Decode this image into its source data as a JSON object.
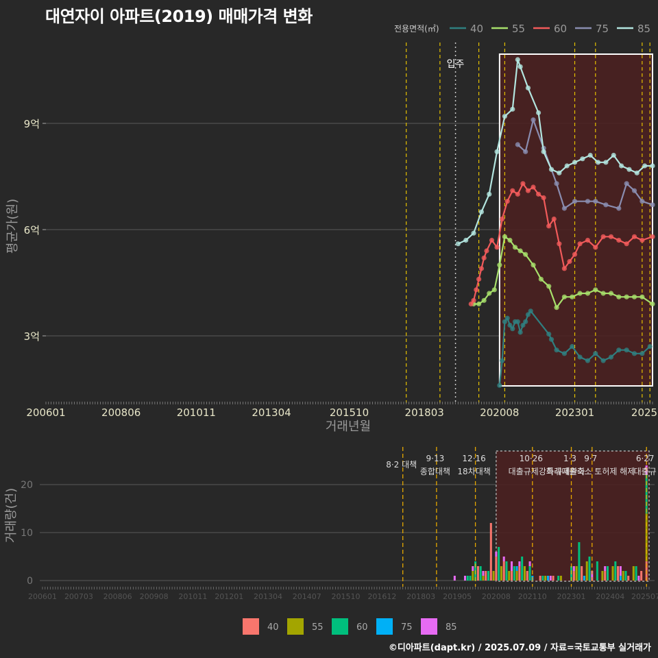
{
  "title": "대연자이 아파트(2019) 매매가격 변화",
  "footer": "©디아파트(dapt.kr) / 2025.07.09 / 자료=국토교통부 실거래가",
  "colors": {
    "background": "#282828",
    "grid": "#5a5a5a",
    "policy_line": "#e6c200",
    "highlight_fill": "#4a2020",
    "highlight_border": "#ffffff"
  },
  "chart_data": [
    {
      "type": "line",
      "title": "대연자이 아파트(2019) 매매가격 변화",
      "xlabel": "거래년월",
      "ylabel": "평균가(원)",
      "x_ticks": [
        "200601",
        "200806",
        "201011",
        "201304",
        "201510",
        "201803",
        "202008",
        "202301",
        "2025"
      ],
      "y_ticks": [
        {
          "value": 3,
          "label": "3억"
        },
        {
          "value": 6,
          "label": "6억"
        },
        {
          "value": 9,
          "label": "9억"
        }
      ],
      "ylim": [
        1.3,
        11.4
      ],
      "legend_title": "전용면적(㎡)",
      "legend_position": "top-right",
      "annotation": "입주",
      "policy_dates": [
        "2017-08",
        "2018-09",
        "2019-12",
        "2020-10",
        "2023-01",
        "2023-09",
        "2025-03",
        "2025-06"
      ],
      "highlight_range": [
        "2020-08",
        "2025-07"
      ],
      "series": [
        {
          "name": "40",
          "color": "#2f7f80",
          "x": [
            "2020-08",
            "2020-09",
            "2020-10",
            "2020-11",
            "2020-12",
            "2021-01",
            "2021-02",
            "2021-03",
            "2021-04",
            "2021-05",
            "2021-06",
            "2021-07",
            "2021-08",
            "2022-03",
            "2022-04",
            "2022-06",
            "2022-09",
            "2022-12",
            "2023-03",
            "2023-06",
            "2023-09",
            "2023-12",
            "2024-03",
            "2024-06",
            "2024-09",
            "2024-12",
            "2025-03",
            "2025-06"
          ],
          "y": [
            1.6,
            2.3,
            3.4,
            3.5,
            3.3,
            3.2,
            3.4,
            3.4,
            3.1,
            3.3,
            3.4,
            3.6,
            3.7,
            3.05,
            2.9,
            2.6,
            2.5,
            2.7,
            2.4,
            2.3,
            2.5,
            2.3,
            2.4,
            2.6,
            2.6,
            2.5,
            2.5,
            2.7
          ]
        },
        {
          "name": "55",
          "color": "#a7e06b",
          "x": [
            "2019-10",
            "2019-12",
            "2020-02",
            "2020-04",
            "2020-06",
            "2020-08",
            "2020-10",
            "2020-12",
            "2021-02",
            "2021-04",
            "2021-06",
            "2021-09",
            "2021-12",
            "2022-03",
            "2022-06",
            "2022-09",
            "2022-12",
            "2023-03",
            "2023-06",
            "2023-09",
            "2023-12",
            "2024-03",
            "2024-06",
            "2024-09",
            "2024-12",
            "2025-03",
            "2025-07"
          ],
          "y": [
            3.9,
            3.9,
            4.0,
            4.2,
            4.3,
            5.0,
            5.8,
            5.7,
            5.5,
            5.4,
            5.3,
            5.0,
            4.6,
            4.4,
            3.8,
            4.1,
            4.1,
            4.2,
            4.2,
            4.3,
            4.2,
            4.2,
            4.1,
            4.1,
            4.1,
            4.1,
            3.9
          ]
        },
        {
          "name": "60",
          "color": "#f25b5b",
          "x": [
            "2019-09",
            "2019-10",
            "2019-11",
            "2019-12",
            "2020-01",
            "2020-02",
            "2020-03",
            "2020-05",
            "2020-07",
            "2020-09",
            "2020-11",
            "2021-01",
            "2021-03",
            "2021-05",
            "2021-07",
            "2021-09",
            "2021-11",
            "2022-01",
            "2022-03",
            "2022-05",
            "2022-07",
            "2022-09",
            "2022-11",
            "2023-01",
            "2023-03",
            "2023-06",
            "2023-09",
            "2023-12",
            "2024-03",
            "2024-06",
            "2024-09",
            "2024-12",
            "2025-03",
            "2025-07"
          ],
          "y": [
            3.9,
            4.0,
            4.3,
            4.6,
            4.9,
            5.2,
            5.4,
            5.7,
            5.5,
            6.3,
            6.8,
            7.1,
            7.0,
            7.3,
            7.1,
            7.2,
            7.0,
            6.9,
            6.1,
            6.3,
            5.6,
            4.9,
            5.1,
            5.3,
            5.6,
            5.7,
            5.5,
            5.8,
            5.8,
            5.7,
            5.6,
            5.8,
            5.7,
            5.8
          ]
        },
        {
          "name": "75",
          "color": "#8a8db0",
          "x": [
            "2021-03",
            "2021-06",
            "2021-09",
            "2022-01",
            "2022-06",
            "2022-09",
            "2023-01",
            "2023-06",
            "2023-09",
            "2024-01",
            "2024-06",
            "2024-09",
            "2024-12",
            "2025-03",
            "2025-07"
          ],
          "y": [
            8.4,
            8.2,
            9.1,
            8.3,
            7.3,
            6.6,
            6.8,
            6.8,
            6.8,
            6.7,
            6.6,
            7.3,
            7.1,
            6.8,
            6.7
          ]
        },
        {
          "name": "85",
          "color": "#b3e6e0",
          "x": [
            "2019-04",
            "2019-07",
            "2019-10",
            "2020-01",
            "2020-04",
            "2020-07",
            "2020-10",
            "2021-01",
            "2021-03",
            "2021-04",
            "2021-07",
            "2021-11",
            "2022-01",
            "2022-04",
            "2022-07",
            "2022-10",
            "2023-01",
            "2023-04",
            "2023-07",
            "2023-10",
            "2024-01",
            "2024-04",
            "2024-07",
            "2024-10",
            "2025-01",
            "2025-04",
            "2025-07"
          ],
          "y": [
            5.6,
            5.7,
            5.9,
            6.5,
            7.0,
            8.2,
            9.2,
            9.4,
            10.8,
            10.6,
            10.0,
            9.3,
            8.2,
            7.7,
            7.6,
            7.8,
            7.9,
            8.0,
            8.1,
            7.9,
            7.9,
            8.1,
            7.8,
            7.7,
            7.6,
            7.8,
            7.8
          ]
        }
      ]
    },
    {
      "type": "bar",
      "xlabel": "",
      "ylabel": "거래량(건)",
      "x_ticks": [
        "200601",
        "200703",
        "200806",
        "200908",
        "201011",
        "201201",
        "201304",
        "201407",
        "201510",
        "201612",
        "201803",
        "201905",
        "202008",
        "202110",
        "202301",
        "202404",
        "202507"
      ],
      "y_ticks": [
        0,
        10,
        20
      ],
      "ylim": [
        -1,
        27
      ],
      "policy_events": [
        {
          "date": "2017-08",
          "label": "8·2 대책",
          "label2": ""
        },
        {
          "date": "2018-09",
          "label": "9·13",
          "label2": "종합대책"
        },
        {
          "date": "2019-12",
          "label": "12·16",
          "label2": "18차대책"
        },
        {
          "date": "2021-10",
          "label": "10·26",
          "label2": "대출규제강화"
        },
        {
          "date": "2023-01",
          "label": "1·3",
          "label2": "규제완화"
        },
        {
          "date": "2023-09",
          "label": "9·7",
          "label2": "특례대출축소 토허제 해제"
        },
        {
          "date": "2025-06",
          "label": "6·27",
          "label2": "대출규"
        }
      ],
      "legend_position": "bottom",
      "series": [
        {
          "name": "40",
          "color": "#f8766d",
          "x": [
            "2020-01",
            "2020-04",
            "2020-06",
            "2020-08",
            "2020-11",
            "2021-02",
            "2021-05",
            "2021-08",
            "2022-01",
            "2022-06",
            "2023-02",
            "2023-05",
            "2024-02",
            "2024-07",
            "2024-11",
            "2025-04",
            "2025-06"
          ],
          "values": [
            3,
            2,
            12,
            5,
            4,
            2,
            3,
            2,
            1,
            1,
            2,
            3,
            2,
            3,
            1,
            2,
            4
          ]
        },
        {
          "name": "55",
          "color": "#a3a500",
          "x": [
            "2019-11",
            "2020-03",
            "2020-07",
            "2020-10",
            "2021-01",
            "2021-04",
            "2021-07",
            "2022-03",
            "2022-09",
            "2023-03",
            "2023-07",
            "2024-01",
            "2024-05",
            "2024-09",
            "2025-01",
            "2025-06"
          ],
          "values": [
            2,
            1,
            2,
            3,
            2,
            2,
            3,
            1,
            1,
            3,
            4,
            2,
            3,
            2,
            3,
            10
          ]
        },
        {
          "name": "60",
          "color": "#00bf7d",
          "x": [
            "2019-09",
            "2019-10",
            "2019-12",
            "2020-02",
            "2020-05",
            "2020-09",
            "2020-12",
            "2021-03",
            "2021-06",
            "2021-09",
            "2022-02",
            "2022-08",
            "2023-01",
            "2023-04",
            "2023-08",
            "2023-11",
            "2024-03",
            "2024-06",
            "2024-10",
            "2025-02",
            "2025-06"
          ],
          "values": [
            1,
            1,
            4,
            3,
            2,
            7,
            4,
            3,
            5,
            3,
            1,
            1,
            3,
            8,
            5,
            4,
            3,
            4,
            2,
            3,
            8
          ]
        },
        {
          "name": "75",
          "color": "#00b0f6",
          "x": [
            "2021-04",
            "2021-10",
            "2022-04",
            "2023-06",
            "2024-08"
          ],
          "values": [
            1,
            1,
            1,
            1,
            1
          ]
        },
        {
          "name": "85",
          "color": "#e76bf3",
          "x": [
            "2019-04",
            "2019-08",
            "2019-11",
            "2020-03",
            "2020-08",
            "2020-11",
            "2021-02",
            "2021-05",
            "2021-09",
            "2022-05",
            "2023-02",
            "2023-09",
            "2024-02",
            "2024-08",
            "2025-03",
            "2025-06"
          ],
          "values": [
            1,
            1,
            1,
            1,
            1,
            1,
            2,
            1,
            1,
            1,
            1,
            2,
            1,
            2,
            1,
            2
          ]
        }
      ]
    }
  ]
}
